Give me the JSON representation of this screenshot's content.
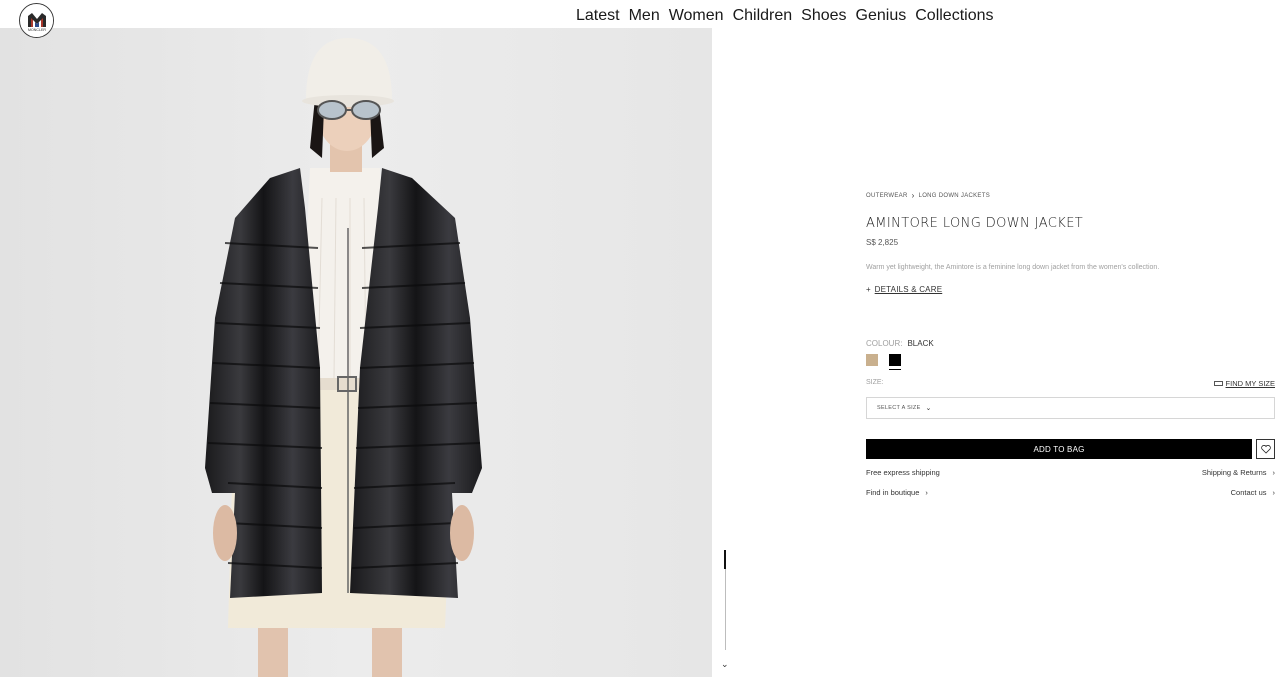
{
  "header": {
    "nav": [
      "Latest",
      "Men",
      "Women",
      "Children",
      "Shoes",
      "Genius",
      "Collections"
    ],
    "logo_text": "MONCLER"
  },
  "product": {
    "breadcrumb": [
      "OUTERWEAR",
      "LONG DOWN JACKETS"
    ],
    "title": "AMINTORE LONG DOWN JACKET",
    "price": "S$ 2,825",
    "description": "Warm yet lightweight, the Amintore is a feminine long down jacket from the women's collection.",
    "details_prefix": "+",
    "details_link": "DETAILS & CARE",
    "colour_label": "COLOUR:",
    "colour_value": "BLACK",
    "swatches": [
      {
        "name": "beige",
        "color": "#c9b08e"
      },
      {
        "name": "black",
        "color": "#000000",
        "selected": true
      }
    ],
    "size_label": "SIZE:",
    "find_size": "FIND MY SIZE",
    "size_placeholder": "SELECT A SIZE",
    "add_to_bag": "ADD TO BAG",
    "links": {
      "free_shipping": "Free express shipping",
      "shipping_returns": "Shipping & Returns",
      "find_boutique": "Find in boutique",
      "contact": "Contact us"
    }
  },
  "colors": {
    "accent": "#000000",
    "image_background": "#e8e8e8"
  }
}
